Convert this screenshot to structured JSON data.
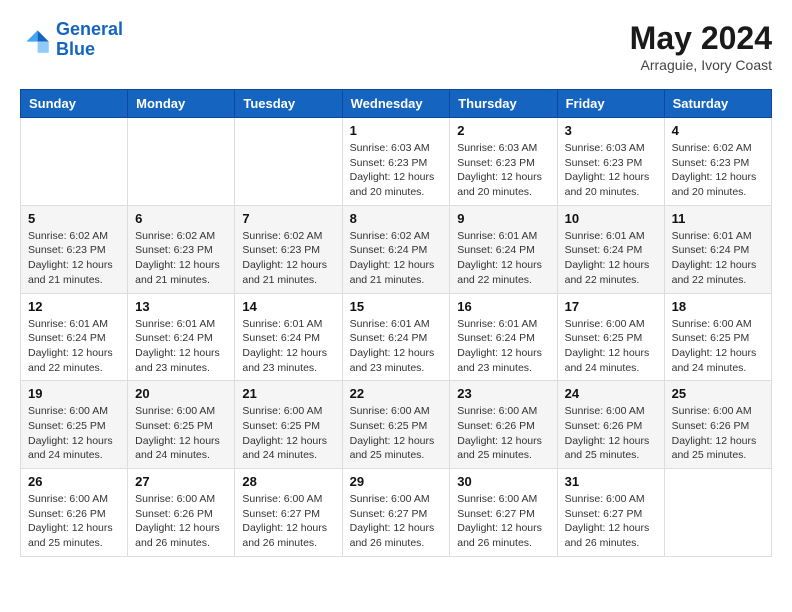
{
  "header": {
    "logo_line1": "General",
    "logo_line2": "Blue",
    "month_year": "May 2024",
    "location": "Arraguie, Ivory Coast"
  },
  "weekdays": [
    "Sunday",
    "Monday",
    "Tuesday",
    "Wednesday",
    "Thursday",
    "Friday",
    "Saturday"
  ],
  "weeks": [
    [
      {
        "day": "",
        "info": ""
      },
      {
        "day": "",
        "info": ""
      },
      {
        "day": "",
        "info": ""
      },
      {
        "day": "1",
        "info": "Sunrise: 6:03 AM\nSunset: 6:23 PM\nDaylight: 12 hours\nand 20 minutes."
      },
      {
        "day": "2",
        "info": "Sunrise: 6:03 AM\nSunset: 6:23 PM\nDaylight: 12 hours\nand 20 minutes."
      },
      {
        "day": "3",
        "info": "Sunrise: 6:03 AM\nSunset: 6:23 PM\nDaylight: 12 hours\nand 20 minutes."
      },
      {
        "day": "4",
        "info": "Sunrise: 6:02 AM\nSunset: 6:23 PM\nDaylight: 12 hours\nand 20 minutes."
      }
    ],
    [
      {
        "day": "5",
        "info": "Sunrise: 6:02 AM\nSunset: 6:23 PM\nDaylight: 12 hours\nand 21 minutes."
      },
      {
        "day": "6",
        "info": "Sunrise: 6:02 AM\nSunset: 6:23 PM\nDaylight: 12 hours\nand 21 minutes."
      },
      {
        "day": "7",
        "info": "Sunrise: 6:02 AM\nSunset: 6:23 PM\nDaylight: 12 hours\nand 21 minutes."
      },
      {
        "day": "8",
        "info": "Sunrise: 6:02 AM\nSunset: 6:24 PM\nDaylight: 12 hours\nand 21 minutes."
      },
      {
        "day": "9",
        "info": "Sunrise: 6:01 AM\nSunset: 6:24 PM\nDaylight: 12 hours\nand 22 minutes."
      },
      {
        "day": "10",
        "info": "Sunrise: 6:01 AM\nSunset: 6:24 PM\nDaylight: 12 hours\nand 22 minutes."
      },
      {
        "day": "11",
        "info": "Sunrise: 6:01 AM\nSunset: 6:24 PM\nDaylight: 12 hours\nand 22 minutes."
      }
    ],
    [
      {
        "day": "12",
        "info": "Sunrise: 6:01 AM\nSunset: 6:24 PM\nDaylight: 12 hours\nand 22 minutes."
      },
      {
        "day": "13",
        "info": "Sunrise: 6:01 AM\nSunset: 6:24 PM\nDaylight: 12 hours\nand 23 minutes."
      },
      {
        "day": "14",
        "info": "Sunrise: 6:01 AM\nSunset: 6:24 PM\nDaylight: 12 hours\nand 23 minutes."
      },
      {
        "day": "15",
        "info": "Sunrise: 6:01 AM\nSunset: 6:24 PM\nDaylight: 12 hours\nand 23 minutes."
      },
      {
        "day": "16",
        "info": "Sunrise: 6:01 AM\nSunset: 6:24 PM\nDaylight: 12 hours\nand 23 minutes."
      },
      {
        "day": "17",
        "info": "Sunrise: 6:00 AM\nSunset: 6:25 PM\nDaylight: 12 hours\nand 24 minutes."
      },
      {
        "day": "18",
        "info": "Sunrise: 6:00 AM\nSunset: 6:25 PM\nDaylight: 12 hours\nand 24 minutes."
      }
    ],
    [
      {
        "day": "19",
        "info": "Sunrise: 6:00 AM\nSunset: 6:25 PM\nDaylight: 12 hours\nand 24 minutes."
      },
      {
        "day": "20",
        "info": "Sunrise: 6:00 AM\nSunset: 6:25 PM\nDaylight: 12 hours\nand 24 minutes."
      },
      {
        "day": "21",
        "info": "Sunrise: 6:00 AM\nSunset: 6:25 PM\nDaylight: 12 hours\nand 24 minutes."
      },
      {
        "day": "22",
        "info": "Sunrise: 6:00 AM\nSunset: 6:25 PM\nDaylight: 12 hours\nand 25 minutes."
      },
      {
        "day": "23",
        "info": "Sunrise: 6:00 AM\nSunset: 6:26 PM\nDaylight: 12 hours\nand 25 minutes."
      },
      {
        "day": "24",
        "info": "Sunrise: 6:00 AM\nSunset: 6:26 PM\nDaylight: 12 hours\nand 25 minutes."
      },
      {
        "day": "25",
        "info": "Sunrise: 6:00 AM\nSunset: 6:26 PM\nDaylight: 12 hours\nand 25 minutes."
      }
    ],
    [
      {
        "day": "26",
        "info": "Sunrise: 6:00 AM\nSunset: 6:26 PM\nDaylight: 12 hours\nand 25 minutes."
      },
      {
        "day": "27",
        "info": "Sunrise: 6:00 AM\nSunset: 6:26 PM\nDaylight: 12 hours\nand 26 minutes."
      },
      {
        "day": "28",
        "info": "Sunrise: 6:00 AM\nSunset: 6:27 PM\nDaylight: 12 hours\nand 26 minutes."
      },
      {
        "day": "29",
        "info": "Sunrise: 6:00 AM\nSunset: 6:27 PM\nDaylight: 12 hours\nand 26 minutes."
      },
      {
        "day": "30",
        "info": "Sunrise: 6:00 AM\nSunset: 6:27 PM\nDaylight: 12 hours\nand 26 minutes."
      },
      {
        "day": "31",
        "info": "Sunrise: 6:00 AM\nSunset: 6:27 PM\nDaylight: 12 hours\nand 26 minutes."
      },
      {
        "day": "",
        "info": ""
      }
    ]
  ]
}
